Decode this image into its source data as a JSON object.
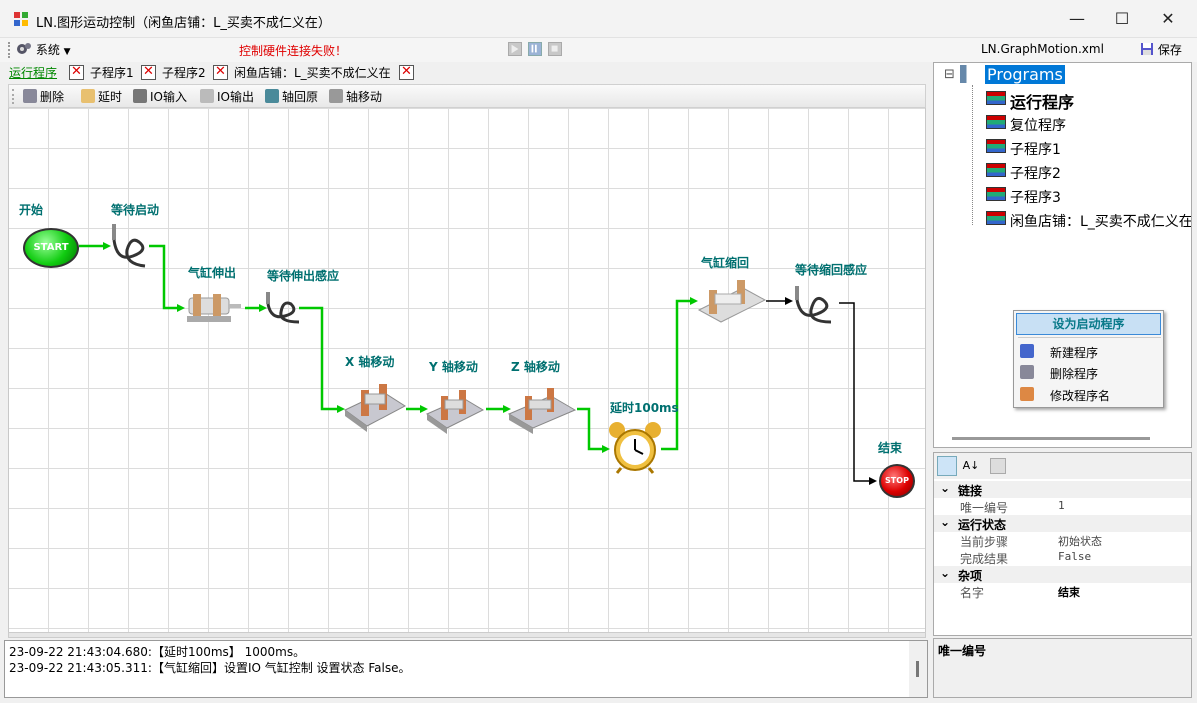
{
  "window": {
    "title": "LN.图形运动控制（闲鱼店铺：L_买卖不成仁义在）",
    "minimize": "—",
    "maximize": "☐",
    "close": "✕"
  },
  "menubar": {
    "system_label": "系统",
    "error_text": "控制硬件连接失败！",
    "file_name": "LN.GraphMotion.xml",
    "save_label": "保存"
  },
  "tabs": [
    {
      "label": "运行程序",
      "active": true
    },
    {
      "label": "子程序1"
    },
    {
      "label": "子程序2"
    },
    {
      "label": "闲鱼店铺：L_买卖不成仁义在"
    }
  ],
  "toolbar": {
    "delete": "删除",
    "delay": "延时",
    "io_in": "IO输入",
    "io_out": "IO输出",
    "axis_home": "轴回原",
    "axis_move": "轴移动"
  },
  "nodes": {
    "start": {
      "label": "开始",
      "badge": "START"
    },
    "wait_start": {
      "label": "等待启动"
    },
    "cyl_extend": {
      "label": "气缸伸出"
    },
    "wait_extend": {
      "label": "等待伸出感应"
    },
    "x_move": {
      "label": "X 轴移动"
    },
    "y_move": {
      "label": "Y 轴移动"
    },
    "z_move": {
      "label": "Z 轴移动"
    },
    "delay": {
      "label": "延时100ms"
    },
    "cyl_retract": {
      "label": "气缸缩回"
    },
    "wait_retract": {
      "label": "等待缩回感应"
    },
    "end": {
      "label": "结束",
      "badge": "STOP"
    }
  },
  "log": [
    "23-09-22 21:43:04.680:【延时100ms】 1000ms。",
    "23-09-22 21:43:05.311:【气缸缩回】设置IO 气缸控制 设置状态 False。"
  ],
  "tree": {
    "root": "Programs",
    "items": [
      "运行程序",
      "复位程序",
      "子程序1",
      "子程序2",
      "子程序3",
      "闲鱼店铺：L_买卖不成仁义在"
    ],
    "collapse_glyph": "⊟"
  },
  "context_menu": {
    "title": "设为启动程序",
    "items": [
      "新建程序",
      "删除程序",
      "修改程序名"
    ]
  },
  "properties": {
    "categories": [
      {
        "name": "链接",
        "rows": [
          {
            "name": "唯一编号",
            "value": "1"
          }
        ]
      },
      {
        "name": "运行状态",
        "rows": [
          {
            "name": "当前步骤",
            "value": "初始状态"
          },
          {
            "name": "完成结果",
            "value": "False"
          }
        ]
      },
      {
        "name": "杂项",
        "rows": [
          {
            "name": "名字",
            "value": "结束"
          }
        ]
      }
    ]
  },
  "description": {
    "title": "唯一编号"
  },
  "colors": {
    "accent_green": "#00c800",
    "label_teal": "#007070",
    "error_red": "#e00000",
    "tree_select": "#0078d7"
  }
}
